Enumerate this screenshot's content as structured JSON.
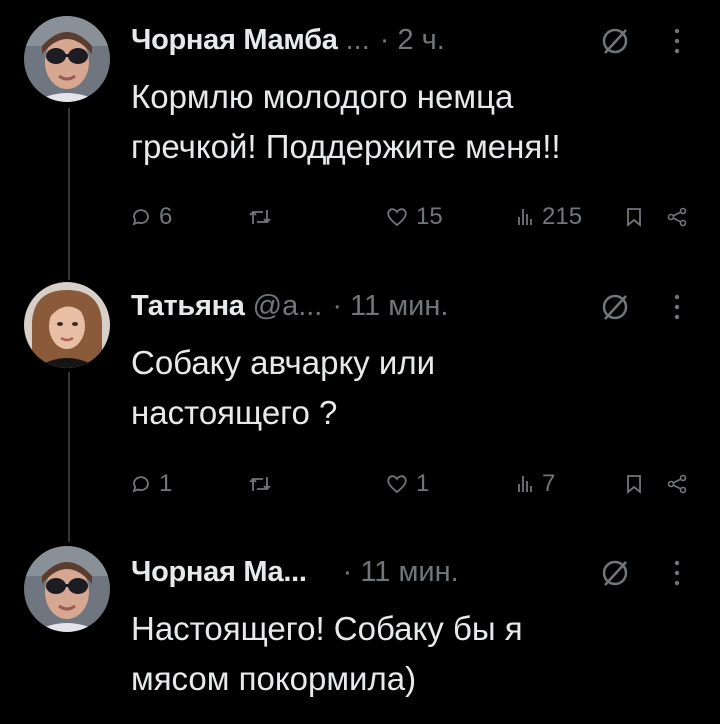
{
  "tweets": [
    {
      "name": "Чорная Мамба",
      "handle": "...",
      "separator": "·",
      "time": "2 ч.",
      "text_lines": [
        "Кормлю молодого немца",
        "гречкой! Поддержите меня!!"
      ],
      "replies": "6",
      "retweets": "",
      "likes": "15",
      "views": "215"
    },
    {
      "name": "Татьяна",
      "handle": "@а...",
      "separator": "·",
      "time": "11 мин.",
      "text_lines": [
        "Собаку авчарку или",
        "настоящего ?"
      ],
      "replies": "1",
      "retweets": "",
      "likes": "1",
      "views": "7"
    },
    {
      "name": "Чорная Ма...",
      "handle": "",
      "separator": "·",
      "time": "11 мин.",
      "text_lines": [
        "Настоящего! Собаку бы я",
        "мясом покормила)"
      ],
      "replies": "",
      "retweets": "",
      "likes": "",
      "views": ""
    }
  ],
  "icons": {
    "reply": "reply-icon",
    "retweet": "retweet-icon",
    "like": "like-icon",
    "views": "views-icon",
    "bookmark": "bookmark-icon",
    "share": "share-icon",
    "grok": "grok-icon",
    "more": "more-icon"
  },
  "colors": {
    "background": "#000000",
    "text": "#e7e9ea",
    "muted": "#71767b",
    "thread_line": "#333639"
  }
}
